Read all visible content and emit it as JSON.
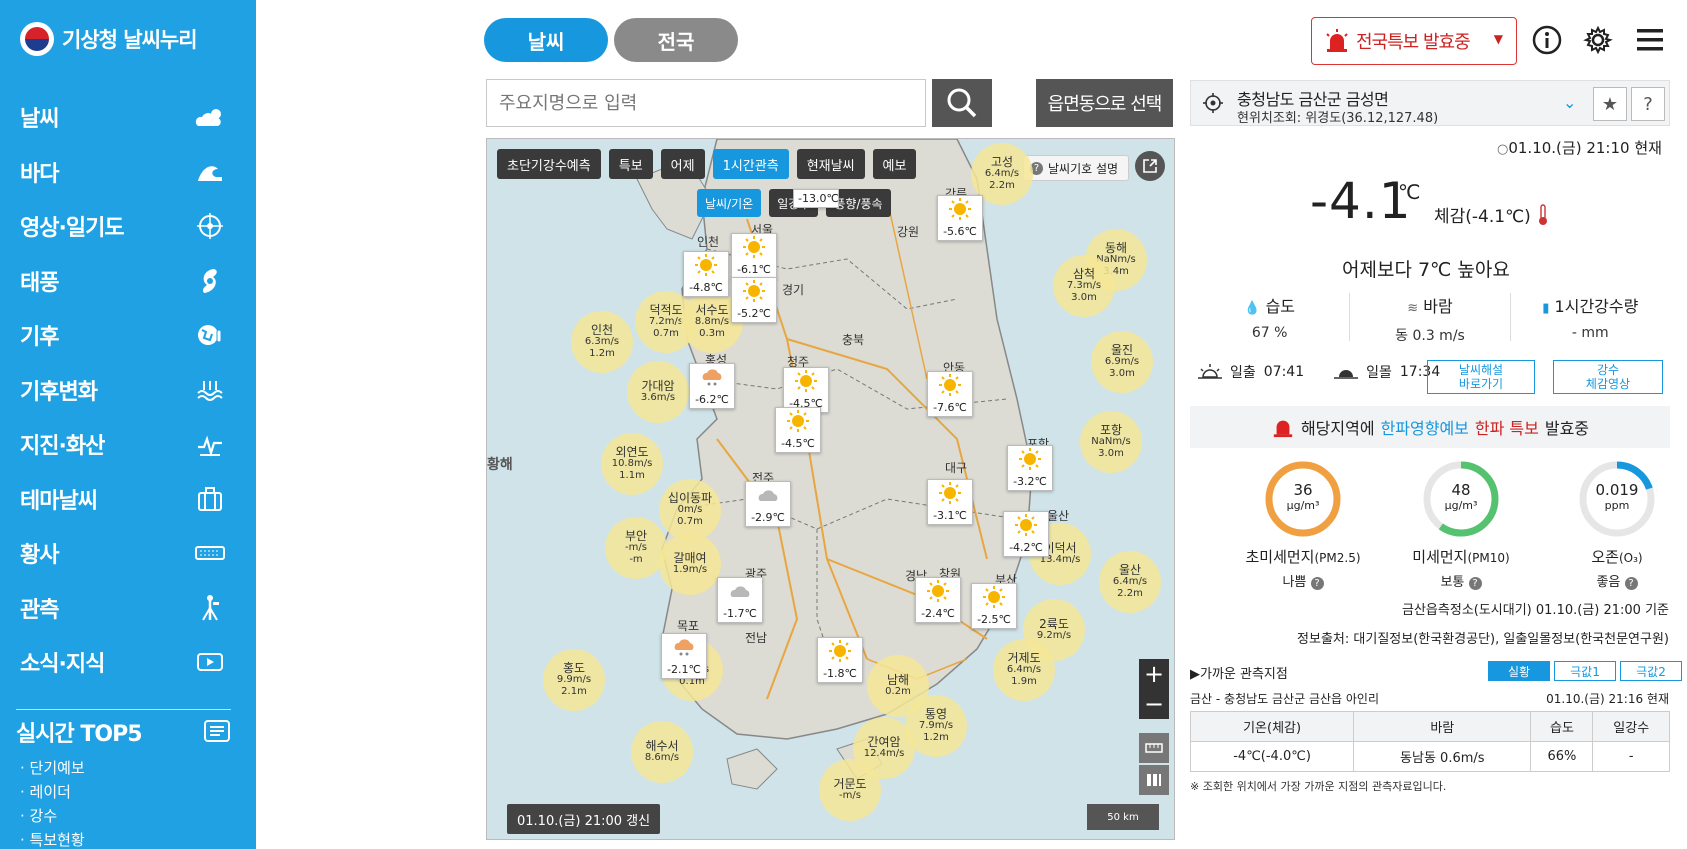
{
  "sidebar": {
    "logo_text": "기상청 날씨누리",
    "items": [
      {
        "label": "날씨",
        "icon": "cloud-sun-icon"
      },
      {
        "label": "바다",
        "icon": "wave-icon"
      },
      {
        "label": "영상·일기도",
        "icon": "satellite-icon"
      },
      {
        "label": "태풍",
        "icon": "typhoon-icon"
      },
      {
        "label": "기후",
        "icon": "globe-thermometer-icon"
      },
      {
        "label": "기후변화",
        "icon": "water-level-icon"
      },
      {
        "label": "지진·화산",
        "icon": "earthquake-icon"
      },
      {
        "label": "테마날씨",
        "icon": "suitcase-icon"
      },
      {
        "label": "황사",
        "icon": "dust-icon"
      },
      {
        "label": "관측",
        "icon": "observation-tower-icon"
      },
      {
        "label": "소식·지식",
        "icon": "video-icon"
      }
    ],
    "top5_label": "실시간 TOP5",
    "top5_items": [
      "· 단기예보",
      "· 레이더",
      "· 강수",
      "· 특보현황"
    ]
  },
  "header": {
    "tab_weather": "날씨",
    "tab_national": "전국",
    "alert_label": "전국특보 발효중",
    "search_placeholder": "주요지명으로 입력",
    "emd_select": "읍면동으로 선택"
  },
  "map": {
    "tabs": [
      "초단기강수예측",
      "특보",
      "어제",
      "1시간관측",
      "현재날씨",
      "예보"
    ],
    "active_tab": "1시간관측",
    "subtabs": [
      "날씨/기온",
      "일강수",
      "풍향/풍속"
    ],
    "active_subtab": "날씨/기온",
    "legend_button": "날씨기호 설명",
    "updated": "01.10.(금) 21:00 갱신",
    "scale": "50 km",
    "sea_label": "황해",
    "land_stations": [
      {
        "temp": "-13.0℃",
        "icon": "none"
      },
      {
        "temp": "-6.1℃",
        "icon": "sun"
      },
      {
        "temp": "-4.8℃",
        "icon": "sun"
      },
      {
        "temp": "-5.2℃",
        "icon": "sun"
      },
      {
        "temp": "-5.6℃",
        "icon": "sun"
      },
      {
        "temp": "-4.5℃",
        "icon": "sun"
      },
      {
        "temp": "-4.5℃",
        "icon": "sun"
      },
      {
        "temp": "-6.2℃",
        "icon": "snow-cloud"
      },
      {
        "temp": "-7.6℃",
        "icon": "sun"
      },
      {
        "temp": "-3.2℃",
        "icon": "sun"
      },
      {
        "temp": "-3.1℃",
        "icon": "sun"
      },
      {
        "temp": "-2.9℃",
        "icon": "cloud"
      },
      {
        "temp": "-4.2℃",
        "icon": "sun"
      },
      {
        "temp": "-1.7℃",
        "icon": "cloud"
      },
      {
        "temp": "-2.4℃",
        "icon": "sun"
      },
      {
        "temp": "-2.5℃",
        "icon": "sun"
      },
      {
        "temp": "-2.1℃",
        "icon": "snow-cloud"
      },
      {
        "temp": "-1.8℃",
        "icon": "sun"
      }
    ],
    "sea_stations": [
      {
        "name": "고성",
        "wind": "6.4m/s",
        "wave": "2.2m"
      },
      {
        "name": "동해",
        "wind": "NaNm/s",
        "wave": "3.4m"
      },
      {
        "name": "삼척",
        "wind": "7.3m/s",
        "wave": "3.0m"
      },
      {
        "name": "울진",
        "wind": "6.9m/s",
        "wave": "3.0m"
      },
      {
        "name": "포항",
        "wind": "NaNm/s",
        "wave": "3.0m"
      },
      {
        "name": "인천",
        "wind": "6.3m/s",
        "wave": "1.2m"
      },
      {
        "name": "덕적도",
        "wind": "7.2m/s",
        "wave": "0.7m"
      },
      {
        "name": "서수도",
        "wind": "8.8m/s",
        "wave": "0.3m"
      },
      {
        "name": "가대암",
        "wind": "3.6m/s",
        "wave": ""
      },
      {
        "name": "외연도",
        "wind": "10.8m/s",
        "wave": "1.1m"
      },
      {
        "name": "십이동파",
        "wind": "0m/s",
        "wave": "0.7m"
      },
      {
        "name": "부안",
        "wind": "-m/s",
        "wave": "-m"
      },
      {
        "name": "갈매여",
        "wind": "1.9m/s",
        "wave": ""
      },
      {
        "name": "이덕서",
        "wind": "13.4m/s",
        "wave": ""
      },
      {
        "name": "울산",
        "wind": "6.4m/s",
        "wave": "2.2m"
      },
      {
        "name": "2륙도",
        "wind": "9.2m/s",
        "wave": ""
      },
      {
        "name": "거제도",
        "wind": "6.4m/s",
        "wave": "1.9m"
      },
      {
        "name": "홍도",
        "wind": "9.9m/s",
        "wave": "2.1m"
      },
      {
        "name": "목포",
        "wind": "0.4m/s",
        "wave": "0.1m"
      },
      {
        "name": "남해",
        "wind": "",
        "wave": "0.2m"
      },
      {
        "name": "통영",
        "wind": "7.9m/s",
        "wave": "1.2m"
      },
      {
        "name": "간여암",
        "wind": "",
        "wave": "12.4m/s"
      },
      {
        "name": "해수서",
        "wind": "8.6m/s",
        "wave": ""
      },
      {
        "name": "거문도",
        "wind": "-m/s",
        "wave": ""
      }
    ],
    "regions": [
      "서울",
      "인천",
      "강원",
      "경기",
      "충북",
      "청주",
      "홍성",
      "안동",
      "포항",
      "대구",
      "울산",
      "전주",
      "광주",
      "창원",
      "부산",
      "경남",
      "전남",
      "목포",
      "강릉"
    ]
  },
  "panel": {
    "location": "충청남도 금산군 금성면",
    "coords": "현위치조회: 위경도(36.12,127.48)",
    "now": "01.10.(금) 21:10 현재",
    "temp": "-4.1",
    "temp_unit": "℃",
    "feels": "체감(-4.1℃)",
    "compare": "어제보다 7℃ 높아요",
    "humidity_label": "습도",
    "humidity": "67 %",
    "wind_label": "바람",
    "wind": "동 0.3 m/s",
    "rain_label": "1시간강수량",
    "rain": "- mm",
    "sunrise_label": "일출",
    "sunrise": "07:41",
    "sunset_label": "일몰",
    "sunset": "17:34",
    "btn_commentary": "날씨해설\n바로가기",
    "btn_feels_video": "강수\n체감영상",
    "notice_pre": "해당지역에",
    "notice_blue": "한파영향예보",
    "notice_red": "한파 특보",
    "notice_post": "발효중",
    "air": [
      {
        "value": "36",
        "unit": "μg/m³",
        "name": "초미세먼지",
        "code": "(PM2.5)",
        "grade": "나쁨",
        "color": "#f0a040",
        "fraction": 1.0
      },
      {
        "value": "48",
        "unit": "μg/m³",
        "name": "미세먼지",
        "code": "(PM10)",
        "grade": "보통",
        "color": "#55c270",
        "fraction": 0.6
      },
      {
        "value": "0.019",
        "unit": "ppm",
        "name": "오존",
        "code": "(O₃)",
        "grade": "좋음",
        "color": "#1697de",
        "fraction": 0.2
      }
    ],
    "station_info": "금산읍측정소(도시대기) 01.10.(금) 21:00 기준",
    "source_info": "정보출처: 대기질정보(한국환경공단), 일출일몰정보(한국천문연구원)",
    "near_title": "▶가까운 관측지점",
    "near_tabs": [
      "실황",
      "극값1",
      "극값2"
    ],
    "near_station": "금산 - 충청남도 금산군 금산읍 아인리",
    "near_time": "01.10.(금) 21:16 현재",
    "table_headers": [
      "기온(체감)",
      "바람",
      "습도",
      "일강수"
    ],
    "table_row": [
      "-4℃(-4.0℃)",
      "동남동 0.6m/s",
      "66%",
      "-"
    ],
    "footnote": "※ 조회한 위치에서 가장 가까운 지점의 관측자료입니다."
  }
}
